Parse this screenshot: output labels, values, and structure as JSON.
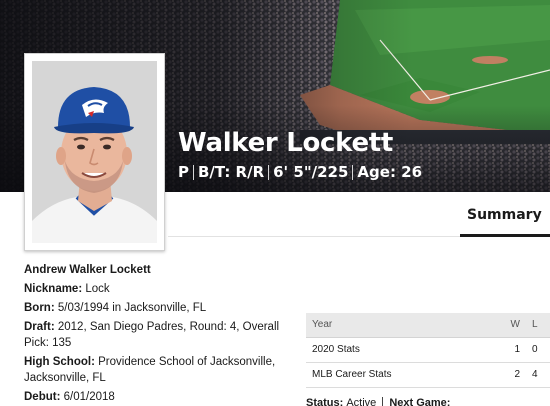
{
  "player": {
    "name": "Walker Lockett",
    "position": "P",
    "bats_throws": "B/T: R/R",
    "height_weight": "6' 5\"/225",
    "age": "Age: 26"
  },
  "tabs": {
    "summary": "Summary"
  },
  "details": {
    "full_name": "Andrew Walker Lockett",
    "nickname_label": "Nickname:",
    "nickname": "Lock",
    "born_label": "Born:",
    "born": "5/03/1994 in Jacksonville, FL",
    "draft_label": "Draft:",
    "draft": "2012, San Diego Padres, Round: 4, Overall Pick: 135",
    "high_school_label": "High School:",
    "high_school": "Providence School of Jacksonville, Jacksonville, FL",
    "debut_label": "Debut:",
    "debut": "6/01/2018"
  },
  "stats": {
    "headers": {
      "year": "Year",
      "w": "W",
      "l": "L"
    },
    "rows": [
      {
        "label": "2020 Stats",
        "w": "1",
        "l": "0"
      },
      {
        "label": "MLB Career Stats",
        "w": "2",
        "l": "4"
      }
    ]
  },
  "status": {
    "status_label": "Status:",
    "status_value": "Active",
    "next_game_label": "Next Game:"
  },
  "colors": {
    "cap_blue": "#1f4fa5",
    "field_green": "#3d8a3d",
    "infield_dirt": "#b9765a"
  },
  "icons": {
    "team_logo": "blue-jays-logo-icon"
  }
}
